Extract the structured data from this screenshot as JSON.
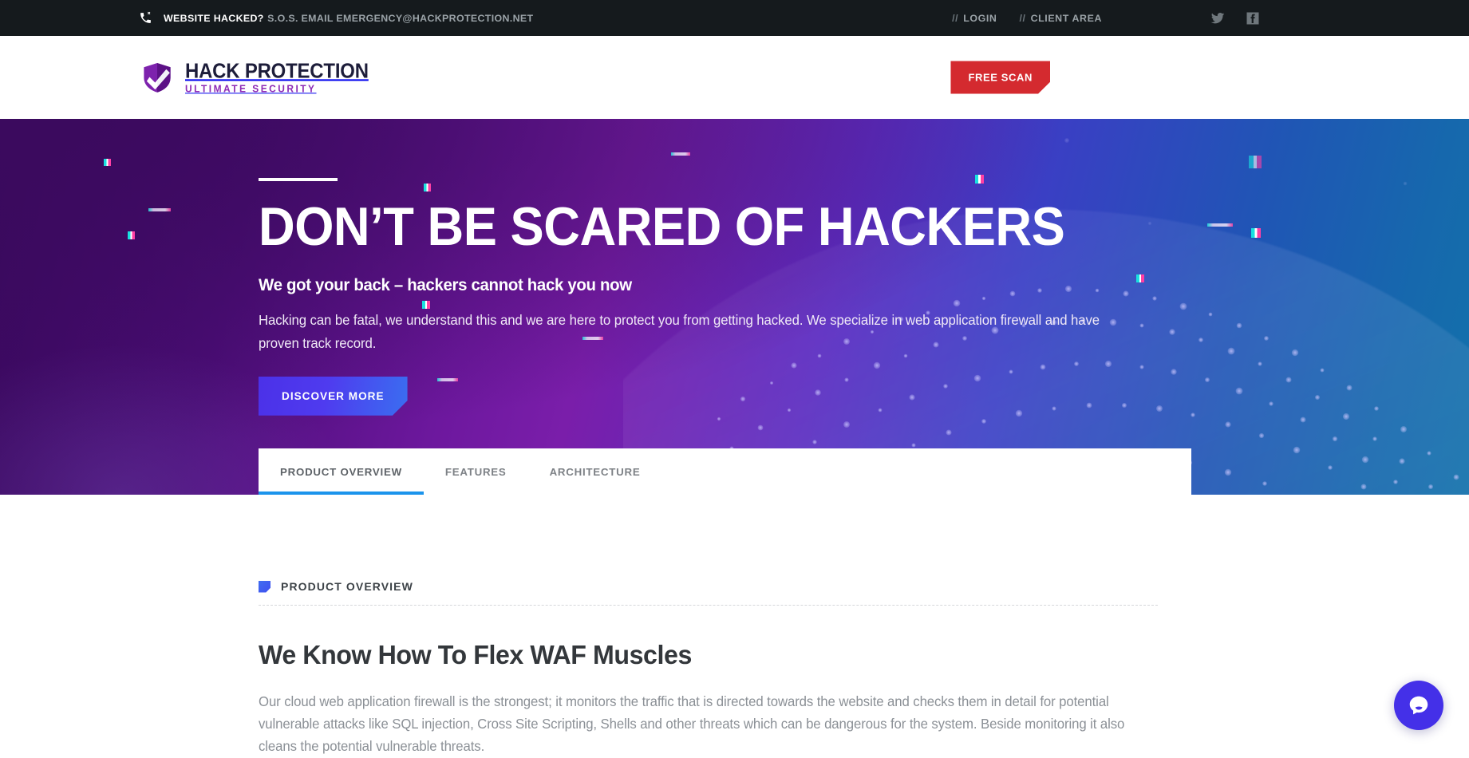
{
  "topbar": {
    "phone_icon": "phone-ring-icon",
    "emergency_strong": "WEBSITE HACKED?",
    "emergency_rest": "S.O.S. EMAIL EMERGENCY@HACKPROTECTION.NET",
    "slashes": "//",
    "login_label": "LOGIN",
    "client_area_label": "CLIENT AREA",
    "twitter_icon": "twitter-icon",
    "facebook_icon": "facebook-icon"
  },
  "header": {
    "logo_icon": "shield-check-icon",
    "logo_main": "HACK PROTECTION",
    "logo_sub": "ULTIMATE SECURITY",
    "free_scan_label": "FREE SCAN",
    "free_scan_color": "#d42a2f"
  },
  "hero": {
    "title": "DON’T BE SCARED OF HACKERS",
    "subtitle": "We got your back – hackers cannot hack you now",
    "paragraph": "Hacking can be fatal, we understand this and we are here to protect you from getting hacked. We specialize in web application firewall and have proven track record.",
    "cta_label": "DISCOVER MORE",
    "cta_color": "#4b31e8",
    "gradient_start": "#38085c",
    "gradient_end": "#1372ab"
  },
  "tabs": [
    {
      "label": "PRODUCT OVERVIEW",
      "active": true
    },
    {
      "label": "FEATURES",
      "active": false
    },
    {
      "label": "ARCHITECTURE",
      "active": false
    }
  ],
  "tab_accent_color": "#1b94ec",
  "section": {
    "eyebrow_icon": "blue-notch-square-icon",
    "eyebrow": "PRODUCT OVERVIEW",
    "title": "We Know How To Flex WAF Muscles",
    "paragraph": "Our cloud web application firewall is the strongest; it monitors the traffic that is directed towards the website and checks them in detail for potential vulnerable attacks like SQL injection, Cross Site Scripting, Shells and other threats which can be dangerous for the system. Beside monitoring it also cleans the potential vulnerable threats."
  },
  "chat": {
    "icon": "chat-bubble-icon",
    "color": "#4430e8"
  }
}
